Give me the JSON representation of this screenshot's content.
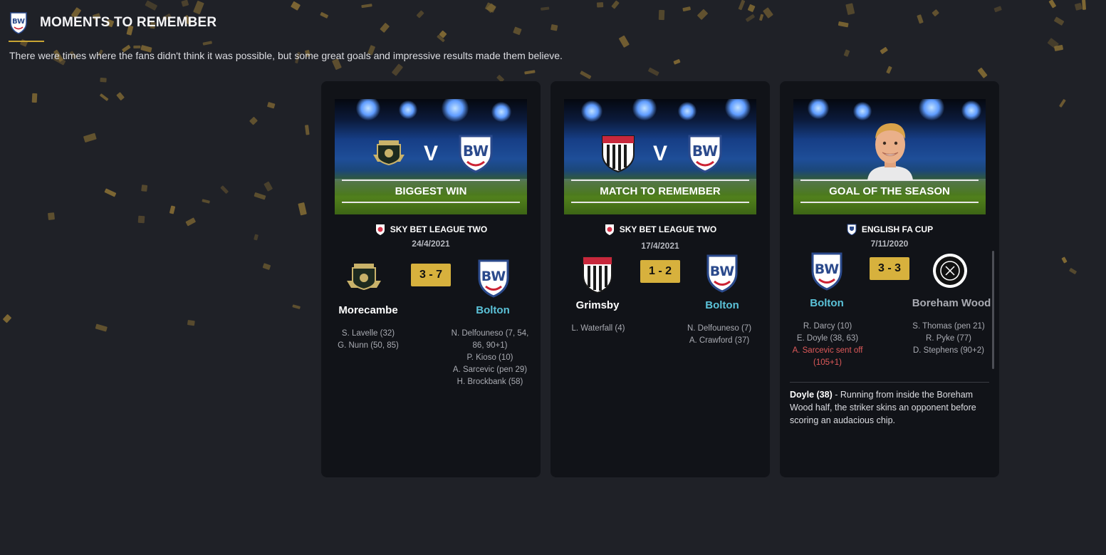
{
  "header": {
    "title": "MOMENTS TO REMEMBER",
    "subtitle": "There were times where the fans didn't think it was possible, but some great goals and impressive results made them believe."
  },
  "colors": {
    "background": "#1f2127",
    "card": "#111318",
    "score_box": "#d7b13d",
    "bolton_accent": "#5bc2d8",
    "confetti": "#8a7035",
    "sent_off": "#e05a5a"
  },
  "cards": [
    {
      "banner_label": "BIGGEST WIN",
      "banner_vs": "V",
      "competition": "SKY BET LEAGUE TWO",
      "competition_icon": "league-two-icon",
      "date": "24/4/2021",
      "score": "3 - 7",
      "home": {
        "name": "Morecambe",
        "crest": "morecambe-crest",
        "scorers": [
          "S. Lavelle (32)",
          "G. Nunn (50, 85)"
        ]
      },
      "away": {
        "name": "Bolton",
        "crest": "bolton-crest",
        "scorers": [
          "N. Delfouneso (7, 54, 86, 90+1)",
          "P. Kioso (10)",
          "A. Sarcevic (pen 29)",
          "H. Brockbank (58)"
        ]
      }
    },
    {
      "banner_label": "MATCH TO REMEMBER",
      "banner_vs": "V",
      "competition": "SKY BET LEAGUE TWO",
      "competition_icon": "league-two-icon",
      "date": "17/4/2021",
      "score": "1 - 2",
      "home": {
        "name": "Grimsby",
        "crest": "grimsby-crest",
        "scorers": [
          "L. Waterfall (4)"
        ]
      },
      "away": {
        "name": "Bolton",
        "crest": "bolton-crest",
        "scorers": [
          "N. Delfouneso (7)",
          "A. Crawford (37)"
        ]
      }
    },
    {
      "banner_label": "GOAL OF THE SEASON",
      "banner_image": "player-portrait",
      "competition": "ENGLISH FA CUP",
      "competition_icon": "fa-cup-icon",
      "date": "7/11/2020",
      "score": "3 - 3",
      "home": {
        "name": "Bolton",
        "crest": "bolton-crest",
        "scorers": [
          "R. Darcy (10)",
          "E. Doyle (38, 63)"
        ],
        "sent_off": "A. Sarcevic sent off (105+1)"
      },
      "away": {
        "name": "Boreham Wood",
        "crest": "boreham-wood-crest",
        "scorers": [
          "S. Thomas (pen 21)",
          "R. Pyke (77)",
          "D. Stephens (90+2)"
        ]
      },
      "goal_scorer": "Doyle (38)",
      "goal_description": " - Running from inside the Boreham Wood half, the striker skins an opponent before scoring an audacious chip."
    }
  ]
}
